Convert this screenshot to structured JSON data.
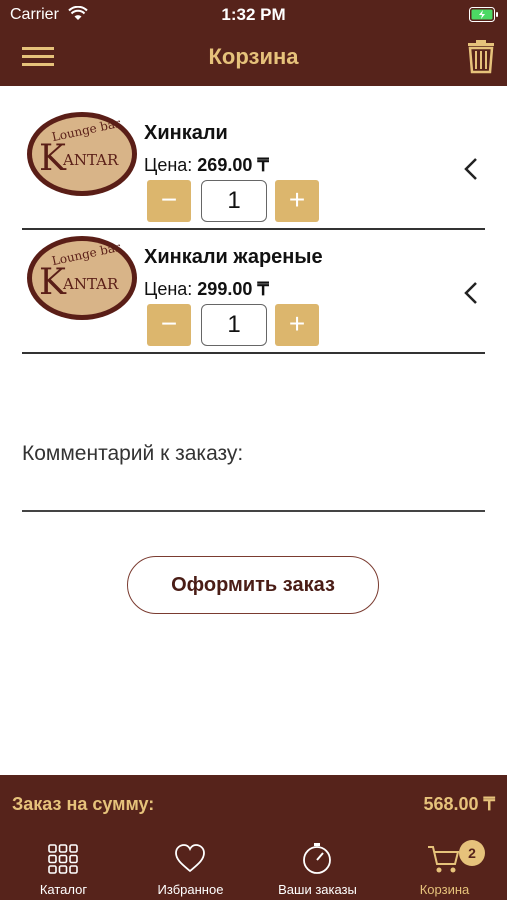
{
  "status_bar": {
    "carrier": "Carrier",
    "time": "1:32 PM"
  },
  "header": {
    "title": "Корзина"
  },
  "cart": {
    "price_label": "Цена:",
    "items": [
      {
        "name": "Хинкали",
        "price": "269.00 ₸",
        "quantity": "1"
      },
      {
        "name": "Хинкали жареные",
        "price": "299.00 ₸",
        "quantity": "1"
      }
    ],
    "stepper": {
      "minus": "−",
      "plus": "+"
    }
  },
  "logo": {
    "text_top": "Lounge bar",
    "text_main": "KANTAR"
  },
  "comment": {
    "label": "Комментарий к заказу:"
  },
  "order_button": {
    "label": "Оформить заказ"
  },
  "total": {
    "label": "Заказ на сумму:",
    "value": "568.00 ₸"
  },
  "tabs": [
    {
      "label": "Каталог",
      "icon": "grid-icon"
    },
    {
      "label": "Избранное",
      "icon": "heart-icon"
    },
    {
      "label": "Ваши заказы",
      "icon": "timer-icon"
    },
    {
      "label": "Корзина",
      "icon": "cart-icon"
    }
  ],
  "cart_badge": "2",
  "colors": {
    "brand": "#56231b",
    "accent": "#e6c27b",
    "stepper": "#dcb66d"
  }
}
